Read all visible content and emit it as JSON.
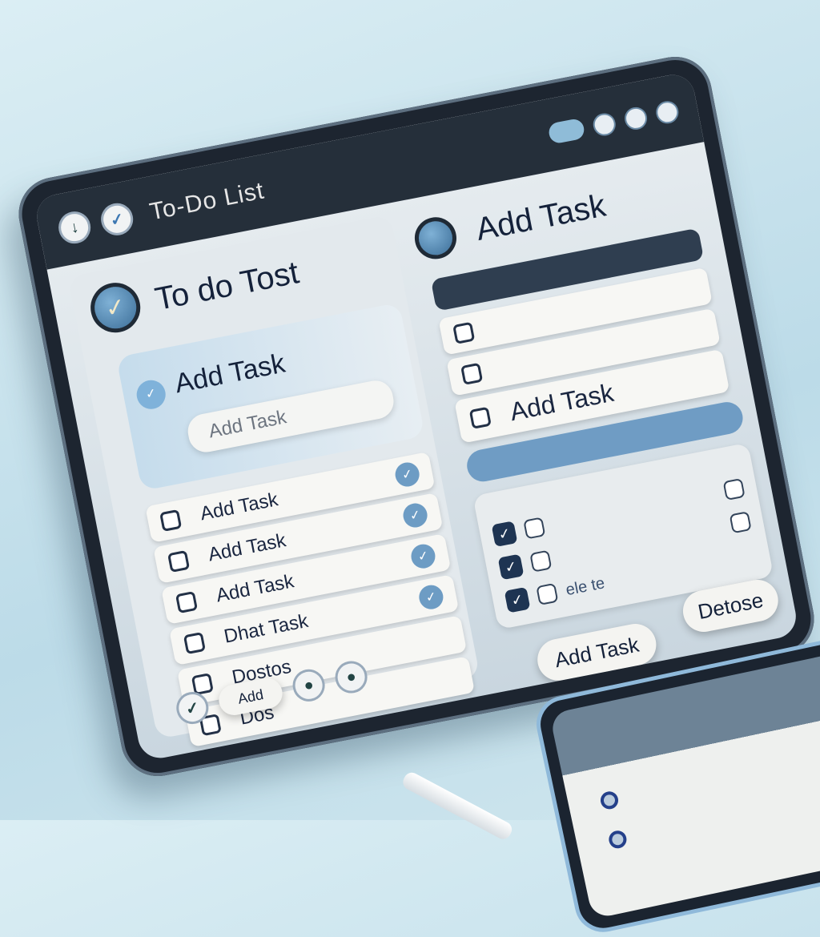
{
  "window": {
    "title": "To-Do List"
  },
  "left_panel": {
    "heading": "To do Tost",
    "card_title": "Add Task",
    "input_placeholder": "Add Task",
    "items": [
      {
        "label": "Add Task",
        "checked": false
      },
      {
        "label": "Add Task",
        "checked": false
      },
      {
        "label": "Add Task",
        "checked": false
      },
      {
        "label": "Dhat Task",
        "checked": false
      },
      {
        "label": "Dostos",
        "checked": false
      },
      {
        "label": "Dos",
        "checked": false
      }
    ],
    "add_button": "Add"
  },
  "right_panel": {
    "heading": "Add Task",
    "highlight_row": "Add Task",
    "table_rows": [
      {
        "checked": true
      },
      {
        "checked": true
      },
      {
        "checked": true,
        "label": "ele te"
      }
    ],
    "add_task_button": "Add Task",
    "delete_button": "Detose"
  },
  "colors": {
    "accent": "#6d9cc4",
    "dark": "#1e3452",
    "frame": "#1d2530"
  }
}
